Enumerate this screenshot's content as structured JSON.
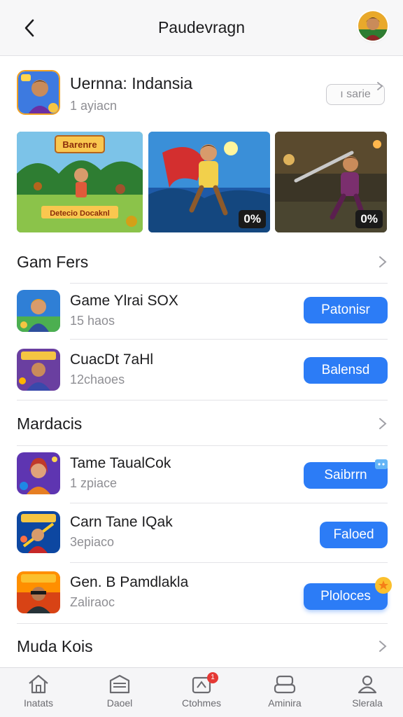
{
  "header": {
    "title": "Paudevragn",
    "back_icon": "chevron-left-icon",
    "avatar": "user-avatar"
  },
  "featured": {
    "title": "Uernna: Indansia",
    "subtitle": "1 ayiacn",
    "button_label": "ı sarie",
    "icon": "featured-game-icon",
    "screenshots": [
      {
        "caption_top": "Barenre",
        "caption_bottom": "Detecio Docaknl",
        "badge": ""
      },
      {
        "caption_top": "",
        "caption_bottom": "",
        "badge": "0%"
      },
      {
        "caption_top": "",
        "caption_bottom": "",
        "badge": "0%"
      }
    ]
  },
  "sections": [
    {
      "title": "Gam Fers",
      "apps": [
        {
          "name": "Game Ylrai SOX",
          "subtitle": "15 haos",
          "button": "Patonisr",
          "icon": "game-hero-icon"
        },
        {
          "name": "CuacDt 7aHl",
          "subtitle": "12chaoes",
          "button": "Balensd",
          "icon": "game-warrior-icon"
        }
      ]
    },
    {
      "title": "Mardacis",
      "apps": [
        {
          "name": "Tame TaualCok",
          "subtitle": "1 zpiace",
          "button": "Saibrrn",
          "icon": "game-girl-icon",
          "badge": "new"
        },
        {
          "name": "Carn Tane IQak",
          "subtitle": "3epiaco",
          "button": "Faloed",
          "icon": "game-action-icon"
        },
        {
          "name": "Gen. B Pamdlakla",
          "subtitle": "Zaliraoc",
          "button": "Ploloces",
          "icon": "game-ninja-icon",
          "badge": "star"
        }
      ]
    },
    {
      "title": "Muda Kois",
      "apps": []
    }
  ],
  "tabbar": {
    "tabs": [
      {
        "label": "Inatats",
        "icon": "home-icon"
      },
      {
        "label": "Daoel",
        "icon": "store-icon"
      },
      {
        "label": "Ctohmes",
        "icon": "games-icon",
        "badge": "1"
      },
      {
        "label": "Aminira",
        "icon": "controller-icon"
      },
      {
        "label": "Slerala",
        "icon": "profile-icon"
      }
    ]
  },
  "colors": {
    "accent": "#2c7cf6",
    "header_bg": "#f7f7f8",
    "text_secondary": "#8e8e93",
    "badge_red": "#e53935"
  }
}
